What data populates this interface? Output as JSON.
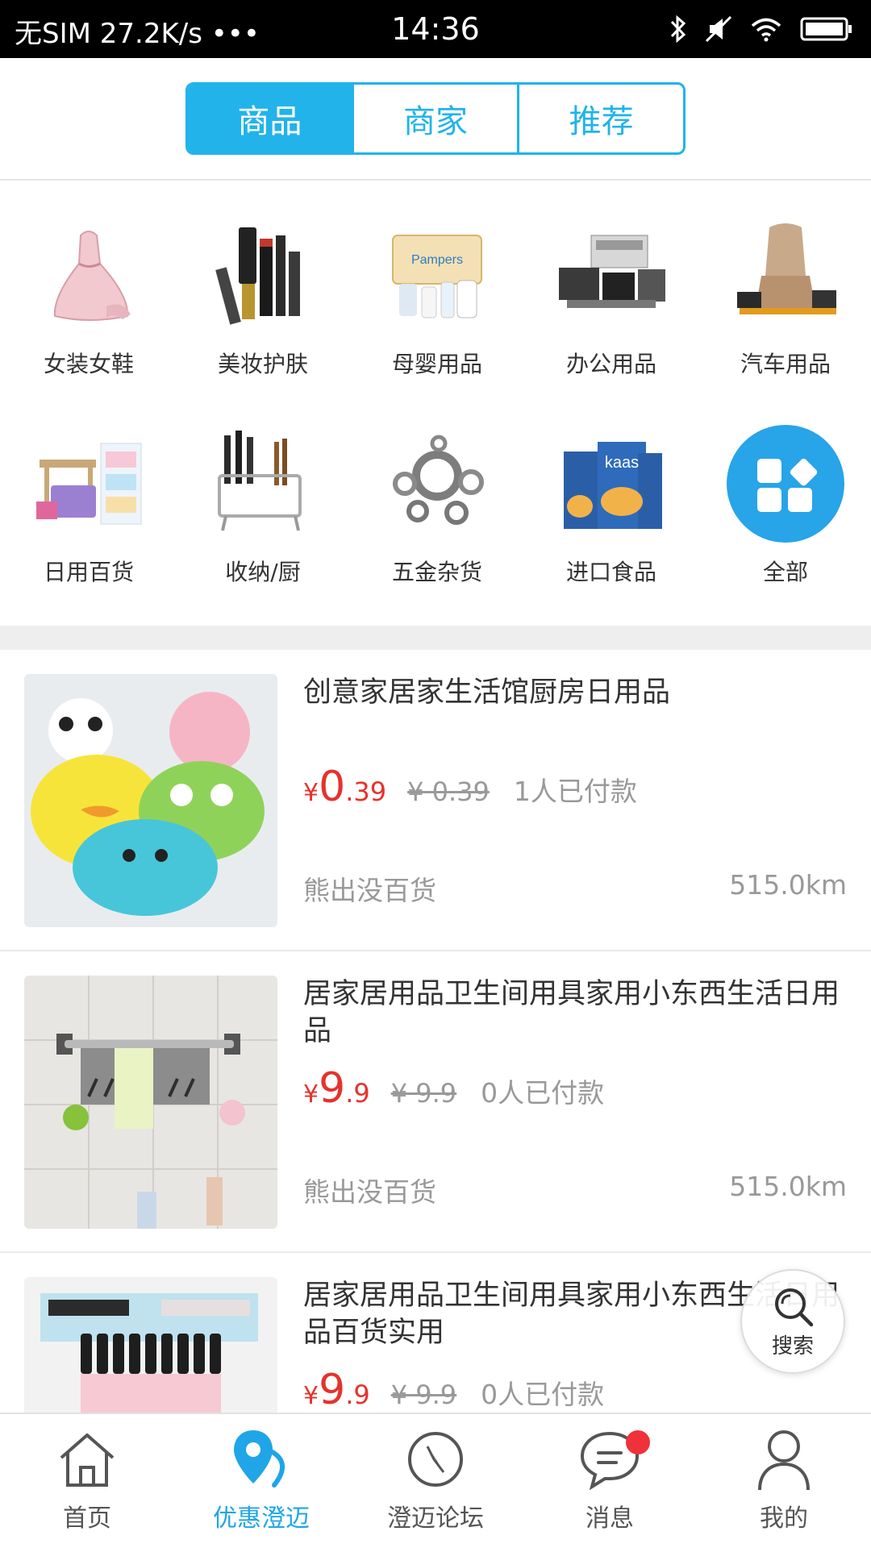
{
  "status_bar": {
    "carrier": "无SIM",
    "speed": "27.2K/s",
    "more": "•••",
    "time": "14:36"
  },
  "segment_tabs": [
    {
      "label": "商品",
      "active": true
    },
    {
      "label": "商家",
      "active": false
    },
    {
      "label": "推荐",
      "active": false
    }
  ],
  "categories": [
    {
      "label": "女装女鞋",
      "icon": "dress-shoes-image"
    },
    {
      "label": "美妆护肤",
      "icon": "cosmetics-image"
    },
    {
      "label": "母婴用品",
      "icon": "baby-products-image"
    },
    {
      "label": "办公用品",
      "icon": "office-supplies-image"
    },
    {
      "label": "汽车用品",
      "icon": "car-accessories-image"
    },
    {
      "label": "日用百货",
      "icon": "storage-box-image"
    },
    {
      "label": "收纳/厨",
      "icon": "knife-rack-image"
    },
    {
      "label": "五金杂货",
      "icon": "bearings-image"
    },
    {
      "label": "进口食品",
      "icon": "imported-food-image"
    },
    {
      "label": "全部",
      "icon": "grid-all-icon"
    }
  ],
  "products": [
    {
      "title": "创意家居家生活馆厨房日用品",
      "currency": "¥",
      "price_int": "0",
      "price_dec": ".39",
      "original_price": "¥ 0.39",
      "paid": "1人已付款",
      "shop": "熊出没百货",
      "distance": "515.0km"
    },
    {
      "title": "居家居用品卫生间用具家用小东西生活日用品",
      "currency": "¥",
      "price_int": "9",
      "price_dec": ".9",
      "original_price": "¥ 9.9",
      "paid": "0人已付款",
      "shop": "熊出没百货",
      "distance": "515.0km"
    },
    {
      "title": "居家居用品卫生间用具家用小东西生活日用品百货实用",
      "currency": "¥",
      "price_int": "9",
      "price_dec": ".9",
      "original_price": "¥ 9.9",
      "paid": "0人已付款",
      "shop": "",
      "distance": ""
    }
  ],
  "search_fab": {
    "label": "搜索"
  },
  "bottom_nav": [
    {
      "label": "首页",
      "icon": "home-icon",
      "active": false
    },
    {
      "label": "优惠澄迈",
      "icon": "location-pin-icon",
      "active": true
    },
    {
      "label": "澄迈论坛",
      "icon": "compass-icon",
      "active": false
    },
    {
      "label": "消息",
      "icon": "message-icon",
      "active": false,
      "badge": true
    },
    {
      "label": "我的",
      "icon": "profile-icon",
      "active": false
    }
  ],
  "colors": {
    "accent": "#21b3ea",
    "price": "#e5322d",
    "badge": "#f0313a"
  }
}
